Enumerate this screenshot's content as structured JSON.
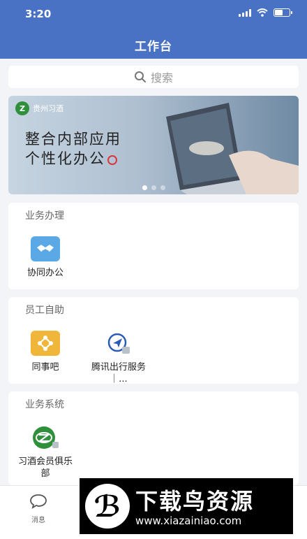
{
  "status_bar": {
    "time": "3:20"
  },
  "header": {
    "title": "工作台"
  },
  "search": {
    "label": "搜索"
  },
  "banner": {
    "brand": "贵州习酒",
    "brand_mark": "Z",
    "slogan_line1": "整合内部应用",
    "slogan_line2": "个性化办公",
    "slide_count": 3,
    "active_slide": 1
  },
  "sections": {
    "business": {
      "title": "业务办理",
      "apps": [
        {
          "label": "协同办公",
          "icon": "handshake-icon",
          "color": "#5aa8e6"
        }
      ]
    },
    "self_service": {
      "title": "员工自助",
      "apps": [
        {
          "label": "同事吧",
          "icon": "network-icon",
          "color": "#f0b63a"
        },
        {
          "label": "腾讯出行服务｜...",
          "icon": "tencent-travel-icon",
          "color": "#2a5bb8"
        }
      ]
    },
    "systems": {
      "title": "业务系统",
      "apps": [
        {
          "label": "习酒会员俱乐部",
          "icon": "xijiu-logo-icon",
          "color": "#2f8f3a"
        }
      ]
    }
  },
  "tabbar": {
    "items": [
      {
        "label": "消息",
        "icon": "message-icon"
      }
    ]
  },
  "watermark": {
    "title": "下载鸟资源",
    "url": "www.xiazainiao.com"
  }
}
